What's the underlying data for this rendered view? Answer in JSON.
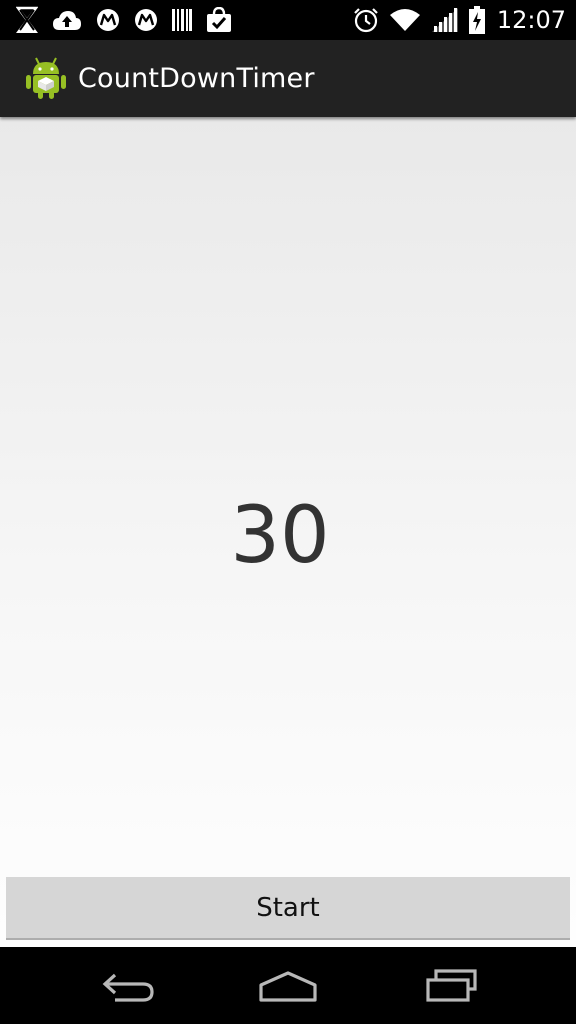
{
  "status_bar": {
    "time": "12:07",
    "left_icons": [
      "notification-x-icon",
      "cloud-upload-icon",
      "motorola-icon",
      "motorola-icon",
      "barcode-icon",
      "shopping-bag-check-icon"
    ],
    "right_icons": [
      "alarm-icon",
      "wifi-icon",
      "cellular-signal-icon",
      "battery-charging-icon"
    ]
  },
  "action_bar": {
    "title": "CountDownTimer",
    "icon": "android-app-icon"
  },
  "main": {
    "timer_value": "30",
    "start_button_label": "Start"
  },
  "nav_bar": {
    "buttons": [
      "back-icon",
      "home-icon",
      "recent-apps-icon"
    ]
  },
  "colors": {
    "status_bar_bg": "#000000",
    "action_bar_bg": "#222222",
    "content_bg_top": "#e9e9e9",
    "content_bg_bottom": "#fefefe",
    "button_bg": "#d6d6d6",
    "android_green": "#97c024"
  }
}
